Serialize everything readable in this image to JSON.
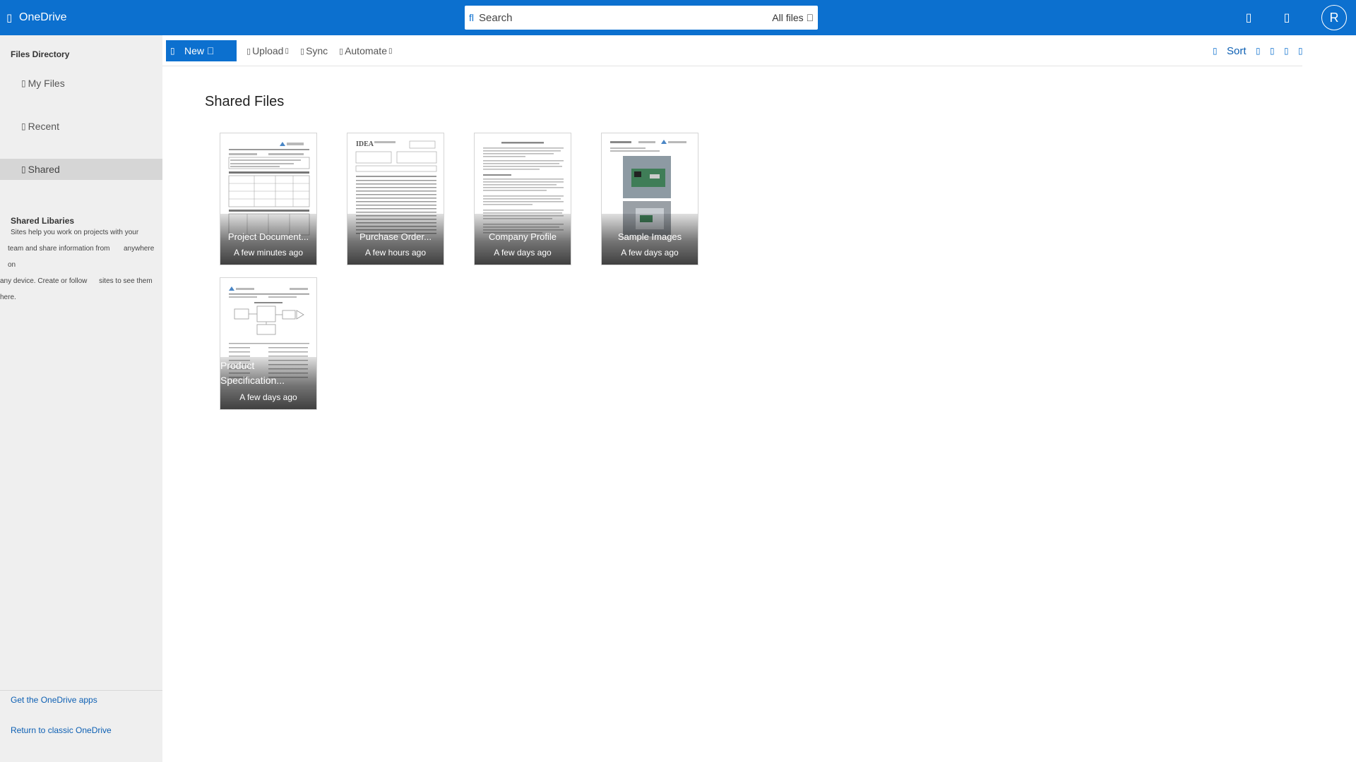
{
  "app": {
    "brand": "OneDrive",
    "waffle_icon": "waffle-icon",
    "accent": "#0c70cf"
  },
  "search": {
    "placeholder": "Search",
    "scope": "All files "
  },
  "header_icons": [
    "settings-icon",
    "help-icon"
  ],
  "user": {
    "initial": "R"
  },
  "sidebar": {
    "files_heading": "Files Directory",
    "items": [
      {
        "label": "My Files",
        "icon": "folder-icon",
        "glyph": ""
      },
      {
        "label": "Recent",
        "icon": "clock-icon",
        "glyph": ""
      },
      {
        "label": "Shared",
        "icon": "share-icon",
        "glyph": "",
        "active": true
      }
    ],
    "libraries_heading": "Shared Libaries",
    "libraries_desc": [
      "Sites help you work on projects with your",
      "team and share information from",
      "anywhere on",
      "any device. Create or follow",
      "sites to see them",
      "here."
    ],
    "footer_links": [
      "Get the OneDrive apps",
      "Return to classic OneDrive"
    ]
  },
  "toolbar": {
    "new_label": "New ",
    "new_icon": "",
    "upload_label": "Upload",
    "sync_label": "Sync",
    "automate_label": "Automate",
    "sort_label": "Sort",
    "glyph": ""
  },
  "main": {
    "title": "Shared Files",
    "files": [
      {
        "name": "Project Document...",
        "date": "A few minutes ago",
        "thumb": "document-form"
      },
      {
        "name": "Purchase Order...",
        "date": "A few hours ago",
        "thumb": "document-table"
      },
      {
        "name": "Company Profile",
        "date": "A few days ago",
        "thumb": "document-text"
      },
      {
        "name": "Sample Images",
        "date": "A few days ago",
        "thumb": "photos"
      },
      {
        "name": "Product Specification...",
        "date": "A few days ago",
        "thumb": "document-diagram"
      }
    ]
  }
}
